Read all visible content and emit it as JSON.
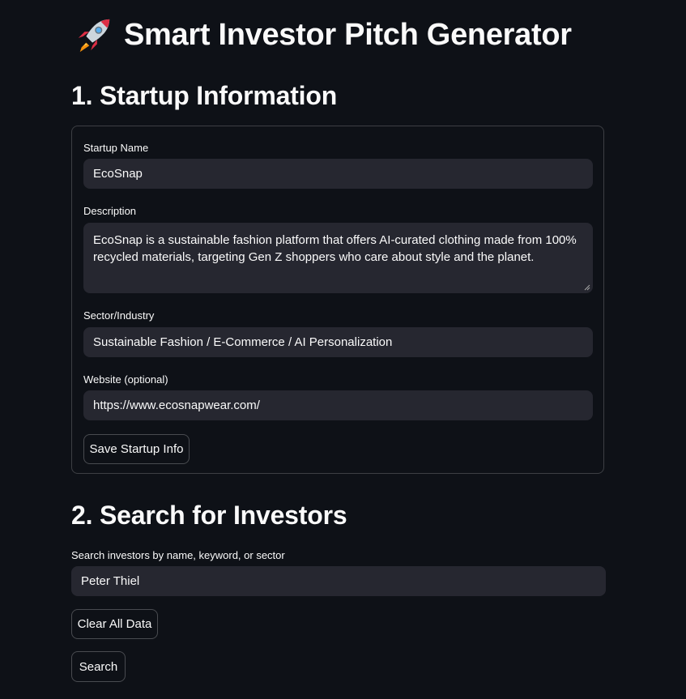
{
  "header": {
    "icon": "rocket-icon",
    "title": "Smart Investor Pitch Generator"
  },
  "startup_section": {
    "heading": "1. Startup Information",
    "name_label": "Startup Name",
    "name_value": "EcoSnap",
    "description_label": "Description",
    "description_value": "EcoSnap is a sustainable fashion platform that offers AI-curated clothing made from 100% recycled materials, targeting Gen Z shoppers who care about style and the planet.",
    "sector_label": "Sector/Industry",
    "sector_value": "Sustainable Fashion / E-Commerce / AI Personalization",
    "website_label": "Website (optional)",
    "website_value": "https://www.ecosnapwear.com/",
    "save_button": "Save Startup Info"
  },
  "investor_section": {
    "heading": "2. Search for Investors",
    "search_label": "Search investors by name, keyword, or sector",
    "search_value": "Peter Thiel",
    "clear_button": "Clear All Data",
    "search_button": "Search"
  },
  "colors": {
    "background": "#0e1117",
    "input_background": "#262730",
    "text": "#fafafa"
  }
}
